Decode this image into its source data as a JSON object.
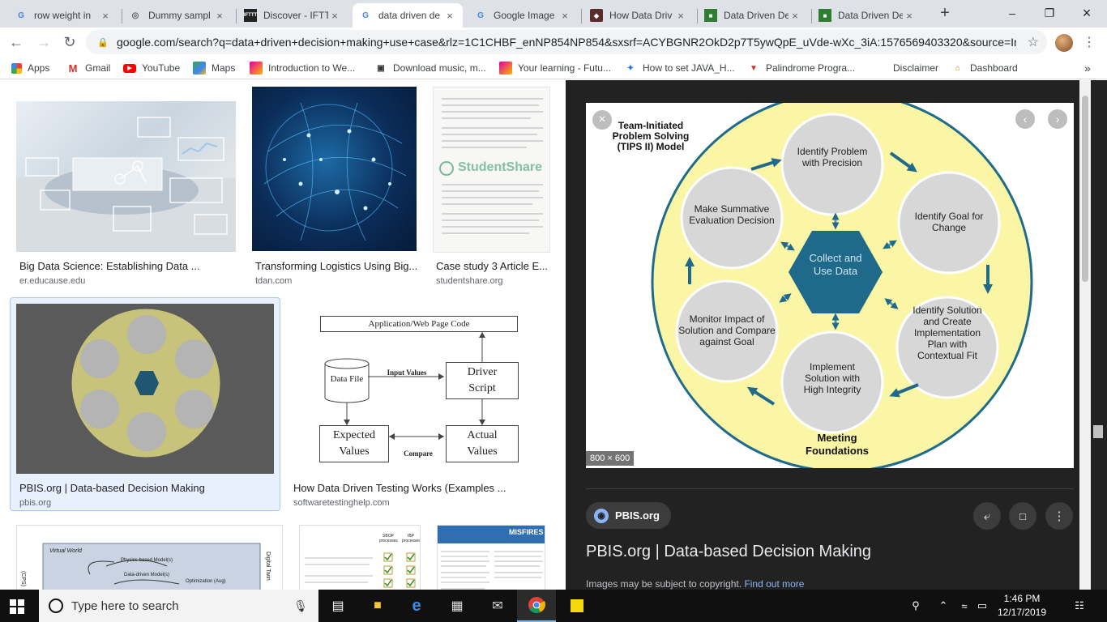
{
  "browser": {
    "tabs": [
      {
        "title": "row weight in",
        "icon": "google-g-icon",
        "active": false
      },
      {
        "title": "Dummy sampl",
        "icon": "globe-icon",
        "active": false
      },
      {
        "title": "Discover - IFTT",
        "icon": "ifttt-icon",
        "active": false
      },
      {
        "title": "data driven de",
        "icon": "google-g-icon",
        "active": true
      },
      {
        "title": "Google Image",
        "icon": "google-g-icon",
        "active": false
      },
      {
        "title": "How Data Driv",
        "icon": "stm-icon",
        "active": false
      },
      {
        "title": "Data Driven De",
        "icon": "pbis-icon",
        "active": false
      },
      {
        "title": "Data Driven De",
        "icon": "pbis-icon",
        "active": false
      }
    ],
    "url": "google.com/search?q=data+driven+decision+making+use+case&rlz=1C1CHBF_enNP854NP854&sxsrf=ACYBGNR2OkD2p7T5ywQpE_uVde-wXc_3iA:1576569403320&source=In...",
    "bookmarks": [
      {
        "label": "Apps",
        "icon": "apps-grid-icon"
      },
      {
        "label": "Gmail",
        "icon": "gmail-icon"
      },
      {
        "label": "YouTube",
        "icon": "youtube-icon"
      },
      {
        "label": "Maps",
        "icon": "maps-icon"
      },
      {
        "label": "Introduction to We...",
        "icon": "future-learn-icon"
      },
      {
        "label": "Download music, m...",
        "icon": "car-icon"
      },
      {
        "label": "Your learning - Futu...",
        "icon": "future-learn-icon"
      },
      {
        "label": "How to set JAVA_H...",
        "icon": "puzzle-icon"
      },
      {
        "label": "Palindrome Progra...",
        "icon": "v-icon"
      },
      {
        "label": "Disclaimer",
        "icon": ""
      },
      {
        "label": "Dashboard",
        "icon": "dashboard-icon"
      }
    ],
    "bookmarks_overflow": "»"
  },
  "results": [
    {
      "title": "Big Data Science: Establishing Data ...",
      "source": "er.educause.edu"
    },
    {
      "title": "Transforming Logistics Using Big...",
      "source": "tdan.com"
    },
    {
      "title": "Case study 3 Article E...",
      "source": "studentshare.org",
      "watermark": "StudentShare"
    },
    {
      "title": "PBIS.org | Data-based Decision Making",
      "source": "pbis.org",
      "selected": true
    },
    {
      "title": "How Data Driven Testing Works (Examples ...",
      "source": "softwaretestinghelp.com"
    }
  ],
  "flowchart": {
    "top": "Application/Web Page Code",
    "data_file": "Data File",
    "input_values": "Input Values",
    "driver": "Driver Script",
    "expected": "Expected Values",
    "compare": "Compare",
    "actual": "Actual Values"
  },
  "bottom_thumbs": {
    "virtual_world": "Virtual World",
    "physics_model": "Physics-based Model(s)",
    "data_model": "Data-driven Model(s)",
    "optimization": "Optimization (Aug)",
    "digital_twin": "Digital Twin",
    "cps": "(CPS)",
    "col1": "SBOP processes",
    "col2": "IBP processes",
    "misfires": "MISFIRES"
  },
  "tips": {
    "title": "Team-Initiated Problem Solving (TIPS II) Model",
    "center": "Collect and Use Data",
    "steps": [
      "Identify Problem with Precision",
      "Identify Goal for Change",
      "Identify Solution and Create Implementation Plan with Contextual Fit",
      "Implement Solution with High Integrity",
      "Monitor Impact of Solution and Compare against Goal",
      "Make Summative Evaluation Decision"
    ],
    "foundation": "Meeting Foundations"
  },
  "preview": {
    "dimensions": "800 × 600",
    "source_name": "PBIS.org",
    "title": "PBIS.org | Data-based Decision Making",
    "copyright_note": "Images may be subject to copyright.",
    "find_out_more": "Find out more"
  },
  "taskbar": {
    "search_placeholder": "Type here to search",
    "time": "1:46 PM",
    "date": "12/17/2019"
  },
  "colors": {
    "tips_outer": "#fbf6a5",
    "tips_hex": "#1f6a8a",
    "tips_circle": "#d7d7d7",
    "tips_arrow": "#1f6a8a",
    "accent": "#1a73e8"
  }
}
